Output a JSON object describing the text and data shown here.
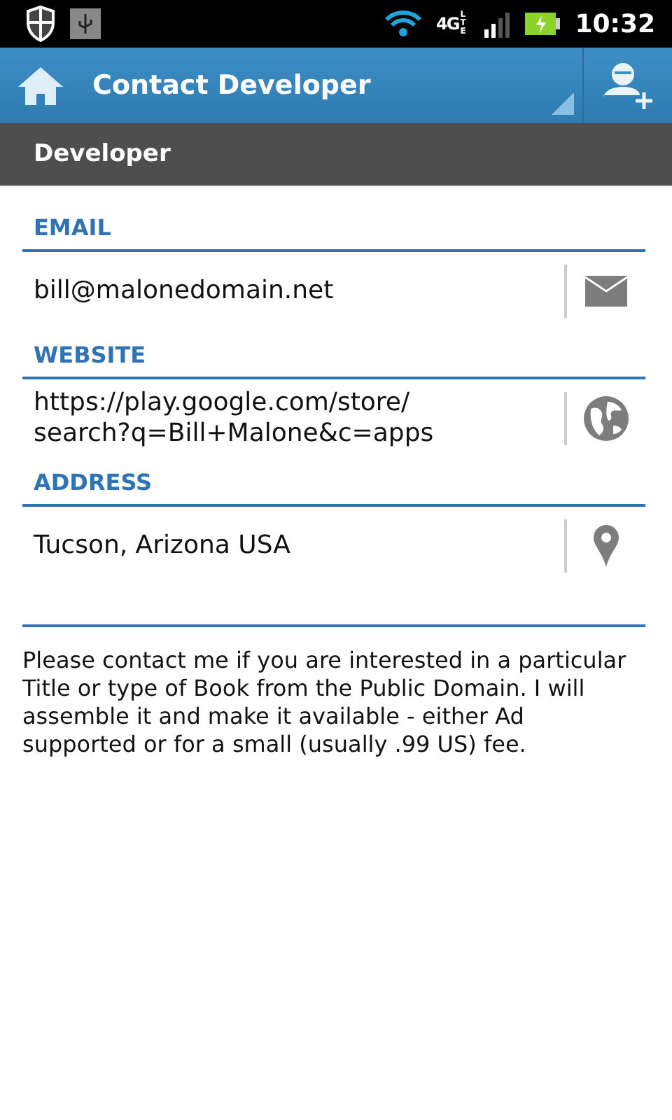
{
  "status_bar": {
    "network": "4G",
    "network_badge": "LTE",
    "time": "10:32"
  },
  "action_bar": {
    "title": "Contact Developer"
  },
  "section": {
    "title": "Developer"
  },
  "fields": [
    {
      "kind": "email",
      "label": "EMAIL",
      "value": "bill@malonedomain.net"
    },
    {
      "kind": "website",
      "label": "WEBSITE",
      "value": "https://play.google.com/store/\nsearch?q=Bill+Malone&c=apps"
    },
    {
      "kind": "address",
      "label": "ADDRESS",
      "value": "Tucson, Arizona USA"
    }
  ],
  "message": "Please contact me if you are interested in a particular Title or type of Book from the Public Domain. I will assemble it and make it available - either Ad supported or for a small (usually .99 US) fee."
}
